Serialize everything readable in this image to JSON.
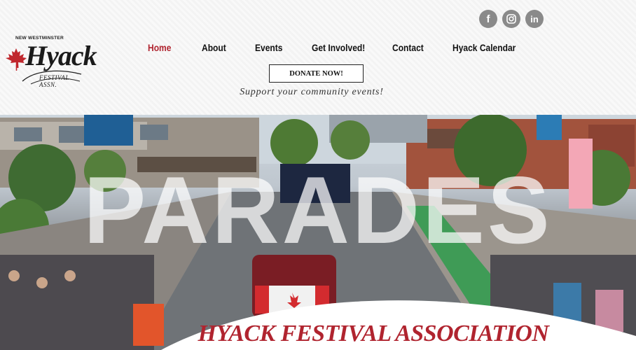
{
  "social": {
    "facebook_glyph": "f",
    "instagram_icon": "instagram-icon",
    "linkedin_glyph": "in",
    "icon_color": "#8a8a8a"
  },
  "logo": {
    "top_text": "NEW WESTMINSTER",
    "main_text": "Hyack",
    "sub_text": "FESTIVAL ASSN.",
    "leaf_color": "#c0272d"
  },
  "nav": {
    "items": [
      {
        "label": "Home",
        "active": true
      },
      {
        "label": "About",
        "active": false
      },
      {
        "label": "Events",
        "active": false
      },
      {
        "label": "Get Involved!",
        "active": false
      },
      {
        "label": "Contact",
        "active": false
      },
      {
        "label": "Hyack Calendar",
        "active": false
      }
    ],
    "active_color": "#b0242f"
  },
  "donate": {
    "label": "DONATE NOW!"
  },
  "tagline": "Support your community events!",
  "hero": {
    "overlay_word": "PARADES",
    "title": "HYACK FESTIVAL ASSOCIATION",
    "title_color": "#b0242f"
  }
}
